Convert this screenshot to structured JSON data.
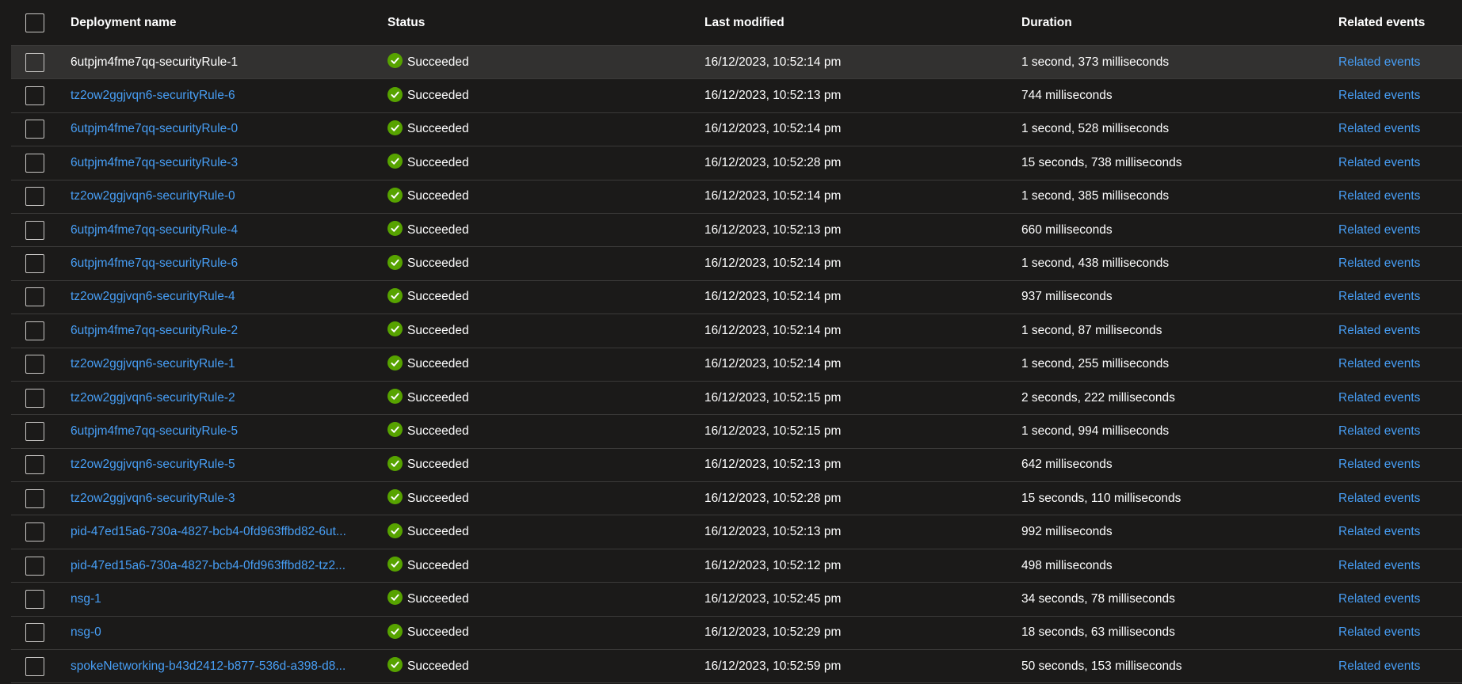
{
  "table": {
    "headers": {
      "name": "Deployment name",
      "status": "Status",
      "modified": "Last modified",
      "duration": "Duration",
      "related": "Related events"
    },
    "rows": [
      {
        "name": "6utpjm4fme7qq-securityRule-1",
        "status": "Succeeded",
        "modified": "16/12/2023, 10:52:14 pm",
        "duration": "1 second, 373 milliseconds",
        "related": "Related events"
      },
      {
        "name": "tz2ow2ggjvqn6-securityRule-6",
        "status": "Succeeded",
        "modified": "16/12/2023, 10:52:13 pm",
        "duration": "744 milliseconds",
        "related": "Related events"
      },
      {
        "name": "6utpjm4fme7qq-securityRule-0",
        "status": "Succeeded",
        "modified": "16/12/2023, 10:52:14 pm",
        "duration": "1 second, 528 milliseconds",
        "related": "Related events"
      },
      {
        "name": "6utpjm4fme7qq-securityRule-3",
        "status": "Succeeded",
        "modified": "16/12/2023, 10:52:28 pm",
        "duration": "15 seconds, 738 milliseconds",
        "related": "Related events"
      },
      {
        "name": "tz2ow2ggjvqn6-securityRule-0",
        "status": "Succeeded",
        "modified": "16/12/2023, 10:52:14 pm",
        "duration": "1 second, 385 milliseconds",
        "related": "Related events"
      },
      {
        "name": "6utpjm4fme7qq-securityRule-4",
        "status": "Succeeded",
        "modified": "16/12/2023, 10:52:13 pm",
        "duration": "660 milliseconds",
        "related": "Related events"
      },
      {
        "name": "6utpjm4fme7qq-securityRule-6",
        "status": "Succeeded",
        "modified": "16/12/2023, 10:52:14 pm",
        "duration": "1 second, 438 milliseconds",
        "related": "Related events"
      },
      {
        "name": "tz2ow2ggjvqn6-securityRule-4",
        "status": "Succeeded",
        "modified": "16/12/2023, 10:52:14 pm",
        "duration": "937 milliseconds",
        "related": "Related events"
      },
      {
        "name": "6utpjm4fme7qq-securityRule-2",
        "status": "Succeeded",
        "modified": "16/12/2023, 10:52:14 pm",
        "duration": "1 second, 87 milliseconds",
        "related": "Related events"
      },
      {
        "name": "tz2ow2ggjvqn6-securityRule-1",
        "status": "Succeeded",
        "modified": "16/12/2023, 10:52:14 pm",
        "duration": "1 second, 255 milliseconds",
        "related": "Related events"
      },
      {
        "name": "tz2ow2ggjvqn6-securityRule-2",
        "status": "Succeeded",
        "modified": "16/12/2023, 10:52:15 pm",
        "duration": "2 seconds, 222 milliseconds",
        "related": "Related events"
      },
      {
        "name": "6utpjm4fme7qq-securityRule-5",
        "status": "Succeeded",
        "modified": "16/12/2023, 10:52:15 pm",
        "duration": "1 second, 994 milliseconds",
        "related": "Related events"
      },
      {
        "name": "tz2ow2ggjvqn6-securityRule-5",
        "status": "Succeeded",
        "modified": "16/12/2023, 10:52:13 pm",
        "duration": "642 milliseconds",
        "related": "Related events"
      },
      {
        "name": "tz2ow2ggjvqn6-securityRule-3",
        "status": "Succeeded",
        "modified": "16/12/2023, 10:52:28 pm",
        "duration": "15 seconds, 110 milliseconds",
        "related": "Related events"
      },
      {
        "name": "pid-47ed15a6-730a-4827-bcb4-0fd963ffbd82-6ut...",
        "status": "Succeeded",
        "modified": "16/12/2023, 10:52:13 pm",
        "duration": "992 milliseconds",
        "related": "Related events"
      },
      {
        "name": "pid-47ed15a6-730a-4827-bcb4-0fd963ffbd82-tz2...",
        "status": "Succeeded",
        "modified": "16/12/2023, 10:52:12 pm",
        "duration": "498 milliseconds",
        "related": "Related events"
      },
      {
        "name": "nsg-1",
        "status": "Succeeded",
        "modified": "16/12/2023, 10:52:45 pm",
        "duration": "34 seconds, 78 milliseconds",
        "related": "Related events"
      },
      {
        "name": "nsg-0",
        "status": "Succeeded",
        "modified": "16/12/2023, 10:52:29 pm",
        "duration": "18 seconds, 63 milliseconds",
        "related": "Related events"
      },
      {
        "name": "spokeNetworking-b43d2412-b877-536d-a398-d8...",
        "status": "Succeeded",
        "modified": "16/12/2023, 10:52:59 pm",
        "duration": "50 seconds, 153 milliseconds",
        "related": "Related events"
      }
    ]
  },
  "colors": {
    "background": "#1b1a19",
    "link": "#479ef5",
    "success": "#57a300",
    "selected_row": "#323130"
  },
  "icons": {
    "status": "success-check-circle-icon",
    "checkbox": "checkbox-unchecked"
  }
}
